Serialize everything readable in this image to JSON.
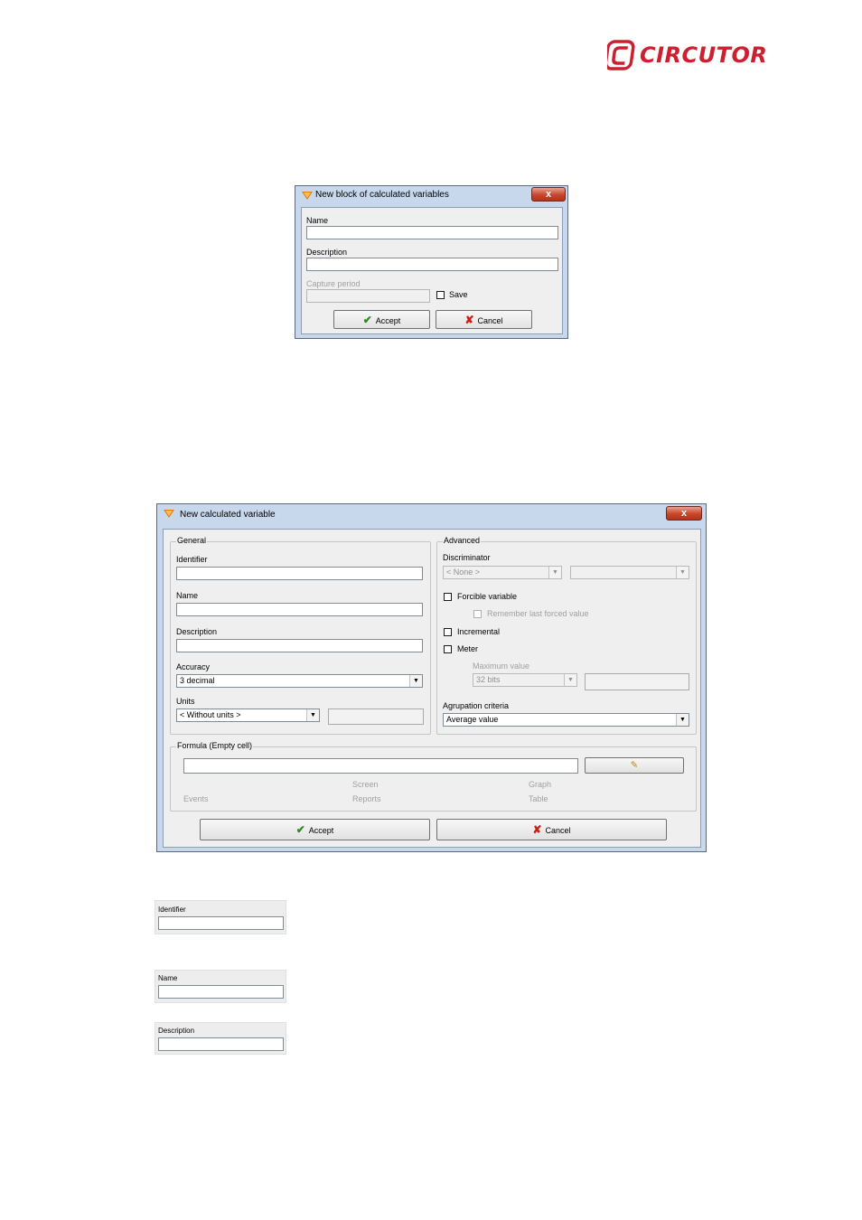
{
  "brand": {
    "name": "CIRCUTOR",
    "color": "#cc1f2f"
  },
  "dialog1": {
    "title": "New block of calculated variables",
    "name_label": "Name",
    "description_label": "Description",
    "capture_label": "Capture period",
    "save_label": "Save",
    "accept_label": "Accept",
    "cancel_label": "Cancel",
    "close_label": "x"
  },
  "dialog2": {
    "title": "New calculated variable",
    "close_label": "x",
    "general": {
      "legend": "General",
      "identifier_label": "Identifier",
      "name_label": "Name",
      "description_label": "Description",
      "accuracy_label": "Accuracy",
      "accuracy_value": "3 decimal",
      "units_label": "Units",
      "units_value": "< Without units >"
    },
    "advanced": {
      "legend": "Advanced",
      "discriminator_label": "Discriminator",
      "discriminator_value": "< None >",
      "forcible_label": "Forcible variable",
      "remember_label": "Remember last forced value",
      "incremental_label": "Incremental",
      "meter_label": "Meter",
      "maxvalue_label": "Maximum value",
      "maxvalue_value": "32 bits",
      "agrupation_label": "Agrupation criteria",
      "agrupation_value": "Average value"
    },
    "formula": {
      "legend": "Formula (Empty cell)",
      "links": [
        "Screen",
        "Graph",
        "Events",
        "Reports",
        "Table"
      ]
    },
    "accept_label": "Accept",
    "cancel_label": "Cancel"
  },
  "snippets": {
    "identifier_label": "Identifier",
    "name_label": "Name",
    "description_label": "Description"
  }
}
